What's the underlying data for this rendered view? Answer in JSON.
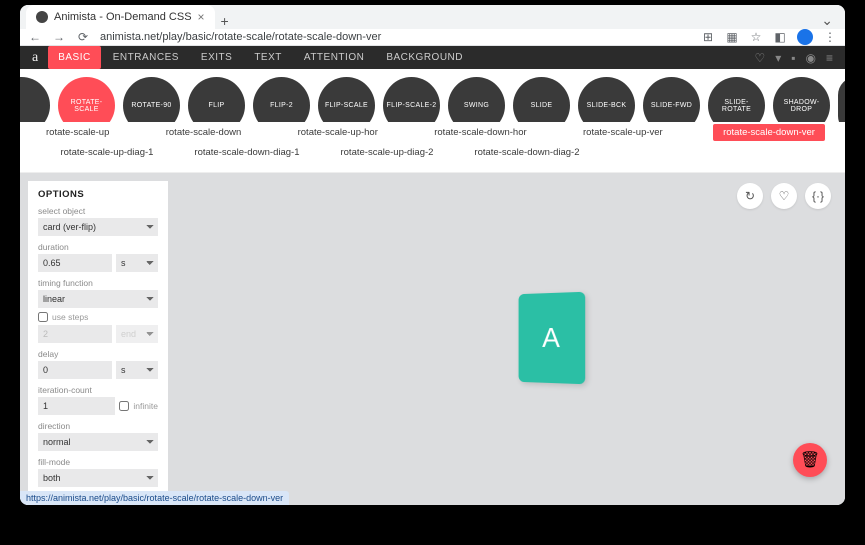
{
  "browser": {
    "tab_title": "Animista - On-Demand CSS",
    "url": "animista.net/play/basic/rotate-scale/rotate-scale-down-ver",
    "status_url": "https://animista.net/play/basic/rotate-scale/rotate-scale-down-ver"
  },
  "nav": {
    "logo": "a",
    "items": [
      "BASIC",
      "ENTRANCES",
      "EXITS",
      "TEXT",
      "ATTENTION",
      "BACKGROUND"
    ],
    "active_index": 0,
    "right_icons": [
      "heart-icon",
      "filter-icon",
      "bell-icon",
      "user-icon",
      "menu-icon"
    ]
  },
  "categories": [
    "ROTATE-SCALE",
    "ROTATE-90",
    "FLIP",
    "FLIP-2",
    "FLIP-SCALE",
    "FLIP-SCALE-2",
    "SWING",
    "SLIDE",
    "SLIDE-BCK",
    "SLIDE-FWD",
    "SLIDE-ROTATE",
    "SHADOW-DROP"
  ],
  "categories_active_index": 0,
  "variants_row1": [
    "rotate-scale-up",
    "rotate-scale-down",
    "rotate-scale-up-hor",
    "rotate-scale-down-hor",
    "rotate-scale-up-ver",
    "rotate-scale-down-ver"
  ],
  "variants_row1_active_index": 5,
  "variants_row2": [
    "rotate-scale-up-diag-1",
    "rotate-scale-down-diag-1",
    "rotate-scale-up-diag-2",
    "rotate-scale-down-diag-2"
  ],
  "options": {
    "title": "OPTIONS",
    "labels": {
      "select_object": "select object",
      "duration": "duration",
      "timing_function": "timing function",
      "use_steps": "use steps",
      "delay": "delay",
      "iteration_count": "iteration-count",
      "infinite": "infinite",
      "direction": "direction",
      "fill_mode": "fill-mode"
    },
    "values": {
      "select_object": "card (ver-flip)",
      "duration": "0.65",
      "duration_unit": "s",
      "timing_function": "linear",
      "use_steps": false,
      "steps_count": "2",
      "steps_pos": "end",
      "delay": "0",
      "delay_unit": "s",
      "iteration_count": "1",
      "infinite": false,
      "direction": "normal",
      "fill_mode": "both"
    }
  },
  "card_letter": "A",
  "stage_buttons": [
    "replay-icon",
    "favorite-icon",
    "code-icon"
  ],
  "stage_button_glyphs": {
    "replay-icon": "↻",
    "favorite-icon": "♡",
    "code-icon": "{·}"
  },
  "colors": {
    "accent": "#ff4d57",
    "card": "#2bbfa5"
  }
}
